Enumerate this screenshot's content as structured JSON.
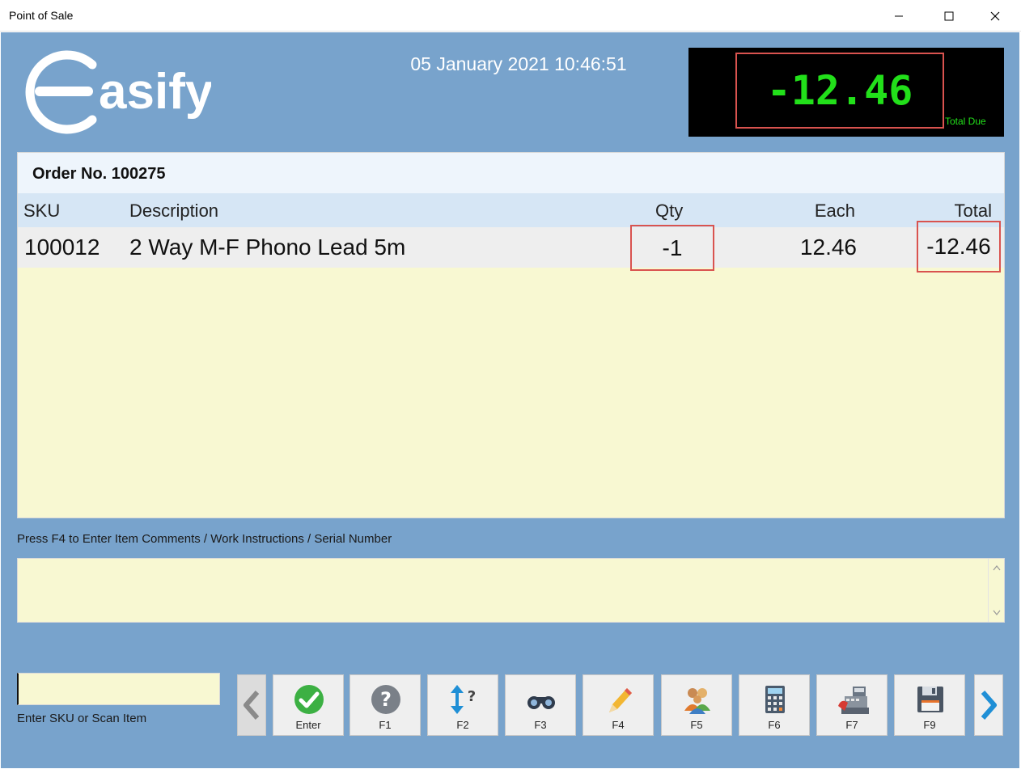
{
  "window": {
    "title": "Point of Sale"
  },
  "header": {
    "brand": "asify",
    "datetime": "05 January 2021 10:46:51",
    "total_due": "-12.46",
    "total_due_label": "Total Due"
  },
  "order": {
    "title": "Order No. 100275",
    "columns": {
      "sku": "SKU",
      "description": "Description",
      "qty": "Qty",
      "each": "Each",
      "total": "Total"
    },
    "items": [
      {
        "sku": "100012",
        "description": "2 Way M-F Phono Lead 5m",
        "qty": "-1",
        "each": "12.46",
        "total": "-12.46"
      }
    ]
  },
  "comments": {
    "hint": "Press F4 to Enter Item Comments / Work Instructions / Serial Number",
    "value": ""
  },
  "sku_entry": {
    "label": "Enter SKU or Scan Item",
    "value": ""
  },
  "toolbar": {
    "buttons": [
      {
        "label": "Enter",
        "icon": "check-icon"
      },
      {
        "label": "F1",
        "icon": "help-icon"
      },
      {
        "label": "F2",
        "icon": "sort-question-icon"
      },
      {
        "label": "F3",
        "icon": "binoculars-icon"
      },
      {
        "label": "F4",
        "icon": "pencil-icon"
      },
      {
        "label": "F5",
        "icon": "customers-icon"
      },
      {
        "label": "F6",
        "icon": "calculator-icon"
      },
      {
        "label": "F7",
        "icon": "cash-register-icon"
      },
      {
        "label": "F9",
        "icon": "save-icon"
      }
    ]
  },
  "colors": {
    "background": "#78a3cc",
    "panel": "#f8f8d2",
    "display_text": "#22e01a",
    "highlight": "#d9534f"
  }
}
